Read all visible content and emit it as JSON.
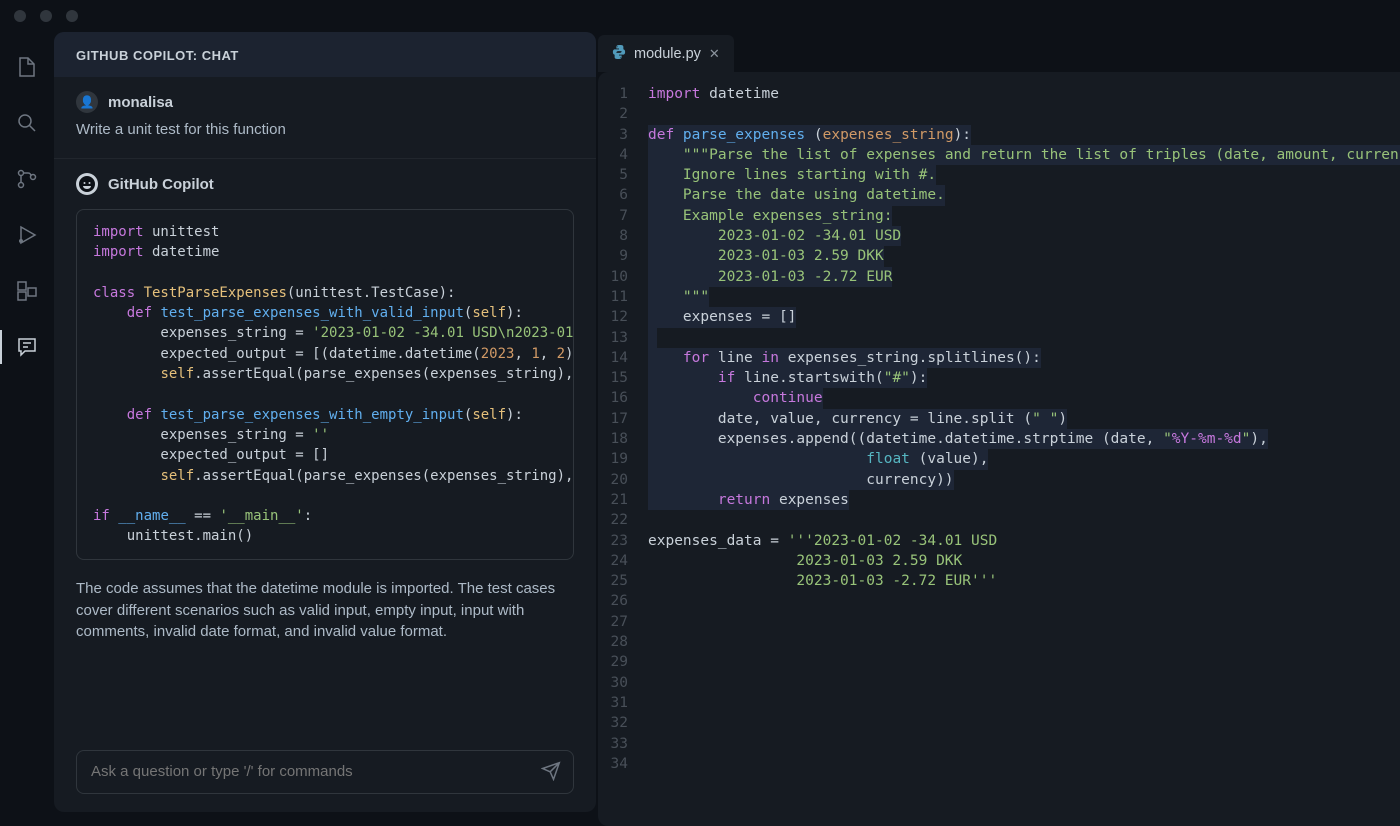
{
  "titlebar": {
    "lights": 3
  },
  "activitybar": {
    "items": [
      {
        "name": "files-icon",
        "active": false
      },
      {
        "name": "search-icon",
        "active": false
      },
      {
        "name": "git-icon",
        "active": false
      },
      {
        "name": "debug-icon",
        "active": false
      },
      {
        "name": "extensions-icon",
        "active": false
      },
      {
        "name": "chat-icon",
        "active": true
      }
    ]
  },
  "chat": {
    "header": "GITHUB COPILOT: CHAT",
    "user": {
      "name": "monalisa",
      "message": "Write a unit test for this function"
    },
    "assistant_name": "GitHub Copilot",
    "code_lines": [
      [
        {
          "t": "import",
          "c": "kw"
        },
        {
          "t": " unittest",
          "c": "ident"
        }
      ],
      [
        {
          "t": "import",
          "c": "kw"
        },
        {
          "t": " datetime",
          "c": "ident"
        }
      ],
      [],
      [
        {
          "t": "class ",
          "c": "kw"
        },
        {
          "t": "TestParseExpenses",
          "c": "cls"
        },
        {
          "t": "(unittest.TestCase):",
          "c": "ident"
        }
      ],
      [
        {
          "t": "    ",
          "c": ""
        },
        {
          "t": "def ",
          "c": "kw"
        },
        {
          "t": "test_parse_expenses_with_valid_input",
          "c": "fn-def"
        },
        {
          "t": "(",
          "c": "punc"
        },
        {
          "t": "self",
          "c": "self"
        },
        {
          "t": "):",
          "c": "punc"
        }
      ],
      [
        {
          "t": "        expenses_string = ",
          "c": "ident"
        },
        {
          "t": "'2023-01-02 -34.01 USD\\n2023-01",
          "c": "str"
        }
      ],
      [
        {
          "t": "        expected_output = [(datetime.datetime(",
          "c": "ident"
        },
        {
          "t": "2023",
          "c": "num"
        },
        {
          "t": ", ",
          "c": "punc"
        },
        {
          "t": "1",
          "c": "num"
        },
        {
          "t": ", ",
          "c": "punc"
        },
        {
          "t": "2",
          "c": "num"
        },
        {
          "t": ")",
          "c": "punc"
        }
      ],
      [
        {
          "t": "        ",
          "c": ""
        },
        {
          "t": "self",
          "c": "self"
        },
        {
          "t": ".assertEqual(parse_expenses(expenses_string),",
          "c": "ident"
        }
      ],
      [],
      [
        {
          "t": "    ",
          "c": ""
        },
        {
          "t": "def ",
          "c": "kw"
        },
        {
          "t": "test_parse_expenses_with_empty_input",
          "c": "fn-def"
        },
        {
          "t": "(",
          "c": "punc"
        },
        {
          "t": "self",
          "c": "self"
        },
        {
          "t": "):",
          "c": "punc"
        }
      ],
      [
        {
          "t": "        expenses_string = ",
          "c": "ident"
        },
        {
          "t": "''",
          "c": "str"
        }
      ],
      [
        {
          "t": "        expected_output = []",
          "c": "ident"
        }
      ],
      [
        {
          "t": "        ",
          "c": ""
        },
        {
          "t": "self",
          "c": "self"
        },
        {
          "t": ".assertEqual(parse_expenses(expenses_string),",
          "c": "ident"
        }
      ],
      [],
      [
        {
          "t": "if ",
          "c": "kw"
        },
        {
          "t": "__name__",
          "c": "fn-def"
        },
        {
          "t": " == ",
          "c": "ident"
        },
        {
          "t": "'__main__'",
          "c": "str"
        },
        {
          "t": ":",
          "c": "punc"
        }
      ],
      [
        {
          "t": "    unittest.main()",
          "c": "ident"
        }
      ]
    ],
    "explanation": "The code assumes that the datetime module is imported. The test cases cover different scenarios such as valid input, empty input, input with comments, invalid date format, and invalid value format.",
    "input_placeholder": "Ask a question or type '/' for commands"
  },
  "editor": {
    "tab": {
      "icon": "python-icon",
      "filename": "module.py"
    },
    "line_count": 34,
    "selection_start": 3,
    "selection_end": 21,
    "code": [
      [
        {
          "t": "import",
          "c": "kw"
        },
        {
          "t": " datetime",
          "c": "ident"
        }
      ],
      [],
      [
        {
          "t": "def ",
          "c": "kw",
          "sel": true
        },
        {
          "t": "parse_expenses",
          "c": "fn-def",
          "sel": true
        },
        {
          "t": " (",
          "c": "punc",
          "sel": true
        },
        {
          "t": "expenses_string",
          "c": "param",
          "sel": true
        },
        {
          "t": "):",
          "c": "punc",
          "sel": true
        }
      ],
      [
        {
          "t": "    ",
          "c": "",
          "sel": true
        },
        {
          "t": "\"\"\"Parse the list of expenses and return the list of triples (date, amount, currency",
          "c": "docstr",
          "sel": true
        }
      ],
      [
        {
          "t": "    Ignore lines starting with #.",
          "c": "docstr",
          "sel": true
        }
      ],
      [
        {
          "t": "    Parse the date using datetime.",
          "c": "docstr",
          "sel": true
        }
      ],
      [
        {
          "t": "    Example expenses_string:",
          "c": "docstr",
          "sel": true
        }
      ],
      [
        {
          "t": "        2023-01-02 -34.01 USD",
          "c": "docstr",
          "sel": true
        }
      ],
      [
        {
          "t": "        2023-01-03 2.59 DKK",
          "c": "docstr",
          "sel": true
        }
      ],
      [
        {
          "t": "        2023-01-03 -2.72 EUR",
          "c": "docstr",
          "sel": true
        }
      ],
      [
        {
          "t": "    \"\"\"",
          "c": "docstr",
          "sel": true
        }
      ],
      [
        {
          "t": "    expenses = []",
          "c": "ident",
          "sel": true
        }
      ],
      [
        {
          "t": " ",
          "c": "",
          "sel": true
        }
      ],
      [
        {
          "t": "    ",
          "c": "",
          "sel": true
        },
        {
          "t": "for",
          "c": "kw",
          "sel": true
        },
        {
          "t": " line ",
          "c": "ident",
          "sel": true
        },
        {
          "t": "in",
          "c": "kw",
          "sel": true
        },
        {
          "t": " expenses_string.splitlines():",
          "c": "ident",
          "sel": true
        }
      ],
      [
        {
          "t": "        ",
          "c": "",
          "sel": true
        },
        {
          "t": "if",
          "c": "kw",
          "sel": true
        },
        {
          "t": " line.startswith(",
          "c": "ident",
          "sel": true
        },
        {
          "t": "\"#\"",
          "c": "str",
          "sel": true
        },
        {
          "t": "):",
          "c": "punc",
          "sel": true
        }
      ],
      [
        {
          "t": "            ",
          "c": "",
          "sel": true
        },
        {
          "t": "continue",
          "c": "kw",
          "sel": true
        }
      ],
      [
        {
          "t": "        date, value, currency = line.split (",
          "c": "ident",
          "sel": true
        },
        {
          "t": "\" \"",
          "c": "str",
          "sel": true
        },
        {
          "t": ")",
          "c": "punc",
          "sel": true
        }
      ],
      [
        {
          "t": "        expenses.append((datetime.datetime.strptime (date, ",
          "c": "ident",
          "sel": true
        },
        {
          "t": "\"",
          "c": "str",
          "sel": true
        },
        {
          "t": "%Y-%m-%d",
          "c": "special",
          "sel": true
        },
        {
          "t": "\"",
          "c": "str",
          "sel": true
        },
        {
          "t": "),",
          "c": "punc",
          "sel": true
        }
      ],
      [
        {
          "t": "                         ",
          "c": "",
          "sel": true
        },
        {
          "t": "float",
          "c": "builtin",
          "sel": true
        },
        {
          "t": " (value),",
          "c": "ident",
          "sel": true
        }
      ],
      [
        {
          "t": "                         currency))",
          "c": "ident",
          "sel": true
        }
      ],
      [
        {
          "t": "        ",
          "c": "",
          "sel": true
        },
        {
          "t": "return",
          "c": "kw",
          "sel": true
        },
        {
          "t": " expenses",
          "c": "ident",
          "sel": true
        }
      ],
      [],
      [
        {
          "t": "expenses_data = ",
          "c": "ident"
        },
        {
          "t": "'''2023-01-02 -34.01 USD",
          "c": "str"
        }
      ],
      [
        {
          "t": "                 2023-01-03 2.59 DKK",
          "c": "str"
        }
      ],
      [
        {
          "t": "                 2023-01-03 -2.72 EUR'''",
          "c": "str"
        }
      ]
    ]
  }
}
